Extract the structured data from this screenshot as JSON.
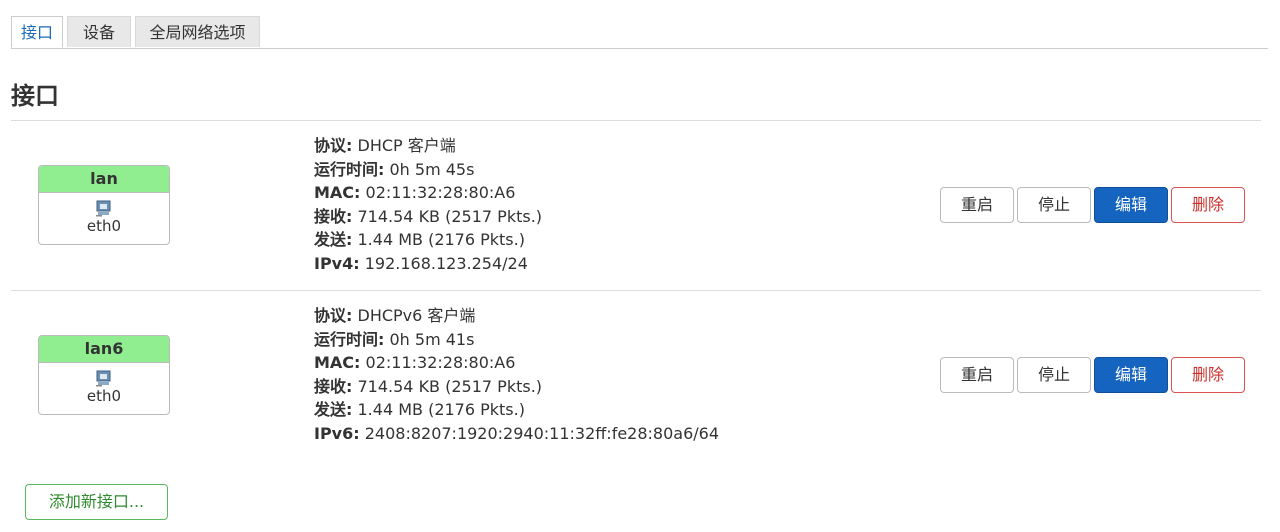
{
  "tabs": [
    {
      "label": "接口",
      "active": true
    },
    {
      "label": "设备",
      "active": false
    },
    {
      "label": "全局网络选项",
      "active": false
    }
  ],
  "section_title": "接口",
  "interfaces": [
    {
      "name": "lan",
      "device": "eth0",
      "icon": "ethernet-port-icon",
      "status_color": "#90ee90",
      "info": [
        {
          "key": "协议:",
          "value": " DHCP 客户端"
        },
        {
          "key": "运行时间:",
          "value": " 0h 5m 45s"
        },
        {
          "key": "MAC:",
          "value": " 02:11:32:28:80:A6"
        },
        {
          "key": "接收:",
          "value": " 714.54 KB (2517 Pkts.)"
        },
        {
          "key": "发送:",
          "value": " 1.44 MB (2176 Pkts.)"
        },
        {
          "key": "IPv4:",
          "value": " 192.168.123.254/24"
        }
      ]
    },
    {
      "name": "lan6",
      "device": "eth0",
      "icon": "ethernet-port-icon",
      "status_color": "#90ee90",
      "info": [
        {
          "key": "协议:",
          "value": " DHCPv6 客户端"
        },
        {
          "key": "运行时间:",
          "value": " 0h 5m 41s"
        },
        {
          "key": "MAC:",
          "value": " 02:11:32:28:80:A6"
        },
        {
          "key": "接收:",
          "value": " 714.54 KB (2517 Pkts.)"
        },
        {
          "key": "发送:",
          "value": " 1.44 MB (2176 Pkts.)"
        },
        {
          "key": "IPv6:",
          "value": " 2408:8207:1920:2940:11:32ff:fe28:80a6/64"
        }
      ]
    }
  ],
  "actions": {
    "restart": "重启",
    "stop": "停止",
    "edit": "编辑",
    "delete": "删除"
  },
  "add_interface_label": "添加新接口...",
  "colors": {
    "accent": "#1565c0",
    "danger": "#c9302c",
    "success": "#2e8b2e"
  }
}
